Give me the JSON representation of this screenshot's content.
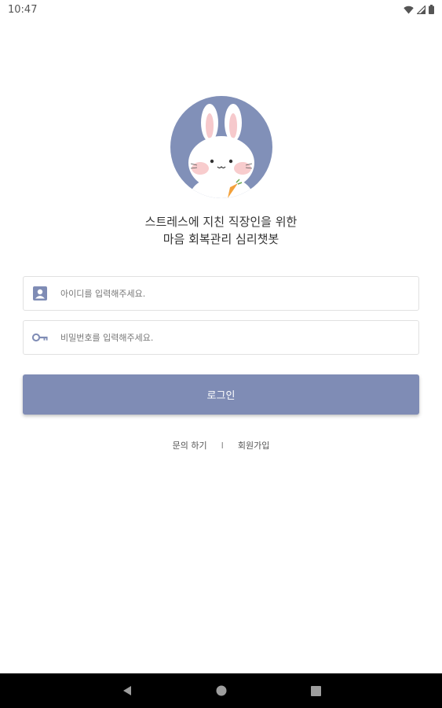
{
  "status_bar": {
    "time": "10:47"
  },
  "tagline": {
    "line1": "스트레스에 지친 직장인을 위한",
    "line2": "마음 회복관리 심리챗봇"
  },
  "login_form": {
    "id_placeholder": "아이디를 입력해주세요.",
    "id_value": "",
    "password_placeholder": "비밀번호를 입력해주세요.",
    "password_value": "",
    "login_label": "로그인"
  },
  "links": {
    "inquiry_label": "문의 하기",
    "separator": "I",
    "signup_label": "회원가입"
  },
  "icons": {
    "id_field": "contact-card-icon",
    "password_field": "key-icon",
    "nav_back": "back-triangle-icon",
    "nav_home": "home-circle-icon",
    "nav_recents": "recents-square-icon"
  },
  "colors": {
    "accent": "#7f8cb5",
    "avatar_bg": "#8190b8",
    "nav_bar": "#000000"
  }
}
